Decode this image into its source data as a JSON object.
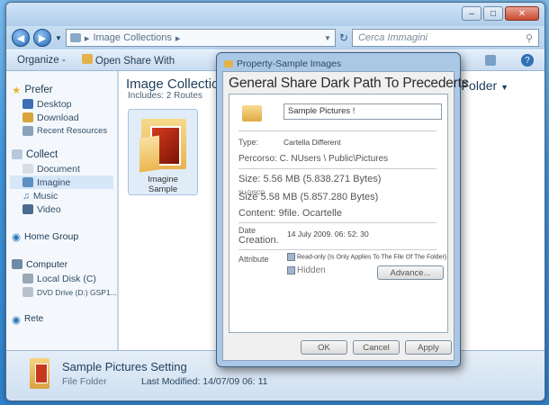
{
  "explorer": {
    "address": "Image Collections",
    "search_placeholder": "Cerca Immagini",
    "toolbar": {
      "organize": "Organize -",
      "open_share": "Open Share With",
      "view_label": ""
    },
    "library": {
      "title": "Image Collection",
      "subtitle": "Includes: 2 Routes",
      "arrange": "Folder"
    },
    "sidebar": {
      "favorites_head": "Prefer",
      "favorites": [
        "Desktop",
        "Download",
        "Recent Resources"
      ],
      "collect_head": "Collect",
      "collect": [
        "Document",
        "Imagine",
        "Music",
        "Video"
      ],
      "homegroup": "Home Group",
      "computer_head": "Computer",
      "computer": [
        "Local Disk (C)",
        "DVD Drive (D:) GSP1..."
      ],
      "network": "Rete"
    },
    "folder_item": {
      "label_line1": "Imagine",
      "label_line2": "Sample"
    },
    "details": {
      "name": "Sample Pictures Setting",
      "type": "File Folder",
      "modified": "Last Modified: 14/07/09 06: 11"
    }
  },
  "dialog": {
    "title": "Property-Sample Images",
    "tabs": "General Share Dark Path To Precederts",
    "name_value": "Sample Pictures !",
    "type_label": "Type:",
    "type_value": "Cartella Different",
    "path_row": "Percorso: C. NUsers \\ Public\\Pictures",
    "size_row": "Size: 5.56 MB (5.838.271 Bytes)",
    "size_disk_row": "Size 5.58 MB (5.857.280 Bytes)",
    "size_disk_label": "SU DISCO",
    "content_row": "Content: 9file. Ocartelle",
    "date_label": "Date",
    "creation_label": "Creation.",
    "date_value": "14 July 2009. 06: 52: 30",
    "attribute_label": "Attribute",
    "readonly_text": "Read-only (Is Only Applies To The File Of The Folder)",
    "hidden_text": "Hidden",
    "advanced_button": "Advance...",
    "ok_button": "OK",
    "cancel_button": "Cancel",
    "apply_button": "Apply"
  },
  "colors": {
    "accent": "#3f95db",
    "title_bar": "#aecde9",
    "close": "#c94a32"
  }
}
